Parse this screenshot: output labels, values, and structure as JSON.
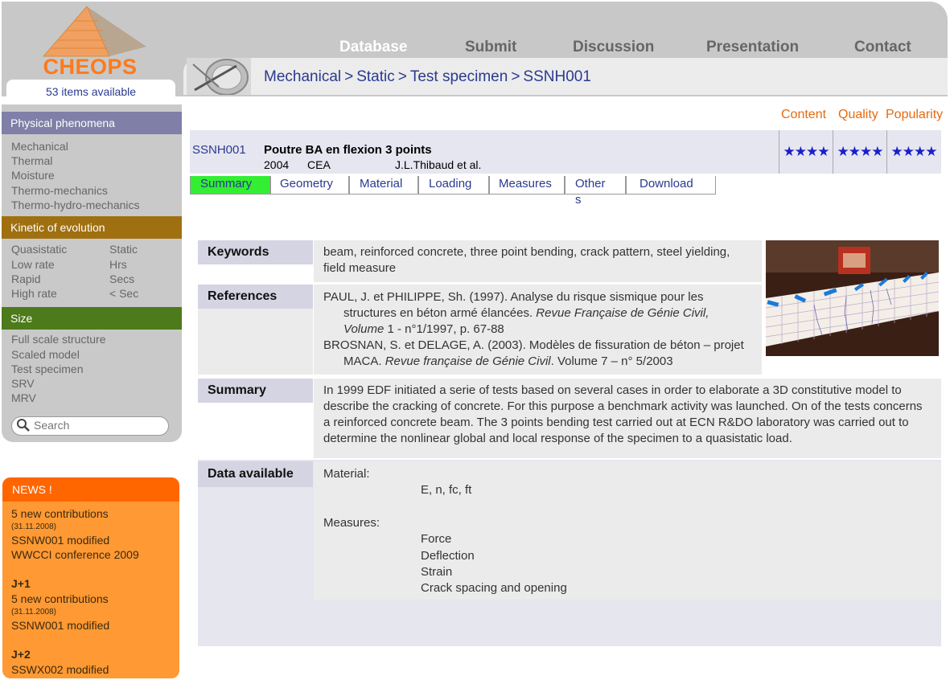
{
  "logo": {
    "text": "CHEOPS"
  },
  "items_available": "53 items available",
  "nav": [
    "Database",
    "Submit",
    "Discussion",
    "Presentation",
    "Contact"
  ],
  "breadcrumb": [
    "Mechanical",
    "Static",
    "Test specimen",
    "SSNH001"
  ],
  "breadcrumb_sep": ">",
  "sidebar": {
    "physical": {
      "title": "Physical phenomena",
      "items": [
        "Mechanical",
        "Thermal",
        "Moisture",
        "Thermo-mechanics",
        "Thermo-hydro-mechanics"
      ]
    },
    "kinetic": {
      "title": "Kinetic of evolution",
      "left": [
        "Quasistatic",
        "Low rate",
        "Rapid",
        "High rate"
      ],
      "right": [
        "Static",
        "Hrs",
        "Secs",
        "< Sec"
      ]
    },
    "size": {
      "title": "Size",
      "items": [
        "Full scale structure",
        "Scaled model",
        "Test specimen",
        "SRV",
        "MRV"
      ]
    },
    "search_placeholder": "Search"
  },
  "news": {
    "title": "NEWS !",
    "lines": {
      "a1": "5 new contributions",
      "a2": "(31.11.2008)",
      "a3": "SSNW001 modified",
      "a4": "WWCCI conference 2009",
      "b0": "J+1",
      "b1": "5 new contributions",
      "b2": "(31.11.2008)",
      "b3": "SSNW001 modified",
      "c0": "J+2",
      "c1": "SSWX002 modified"
    }
  },
  "ratings": {
    "labels": [
      "Content",
      "Quality",
      "Popularity"
    ],
    "stars": [
      "★★★★",
      "★★★★",
      "★★★★"
    ]
  },
  "item": {
    "code": "SSNH001",
    "title": "Poutre BA en flexion 3 points",
    "year": "2004",
    "org": "CEA",
    "authors": "J.L.Thibaud et al."
  },
  "tabs": [
    "Summary",
    "Geometry",
    "Material",
    "Loading",
    "Measures",
    "Others",
    "Download"
  ],
  "active_tab": "Summary",
  "details": {
    "keywords_label": "Keywords",
    "keywords": "beam, reinforced concrete, three point bending, crack pattern, steel yielding, field measure",
    "references_label": "References",
    "ref1_main": "PAUL, J. et PHILIPPE,  Sh. (1997). Analyse du risque sismique pour les structures en béton armé élancées. ",
    "ref1_journal": "Revue Française de Génie Civil",
    "ref1_vol": ", Volume",
    "ref1_tail": " 1 - n°1/1997, p. 67-88",
    "ref2_main": "BROSNAN, S. et DELAGE, A. (2003). Modèles de fissuration de béton – projet MACA.  ",
    "ref2_journal": "Revue française de Génie Civil",
    "ref2_tail": ". Volume  7 – n° 5/2003",
    "summary_label": "Summary",
    "summary": "In 1999 EDF initiated a serie of tests based on several cases in order to elaborate a 3D constitutive model to describe the cracking of concrete. For this purpose a benchmark activity was launched. On of the tests concerns a reinforced concrete beam.  The 3 points bending test carried out at ECN R&DO laboratory was carried out to determine  the nonlinear global and local response of the specimen to a quasistatic load.",
    "data_label": "Data available",
    "material_title": "Material:",
    "material_values": "E, n, fc, ft",
    "measures_title": "Measures:",
    "measures": [
      "Force",
      "Deflection",
      "Strain",
      "Crack spacing and opening"
    ]
  },
  "colors": {
    "physical_head": "#7f7fa8",
    "kinetic_head": "#a07010",
    "size_head": "#4d7a1a",
    "accent_orange": "#ff7a1a",
    "link_blue": "#2a3a8f",
    "active_tab": "#33ee33"
  }
}
